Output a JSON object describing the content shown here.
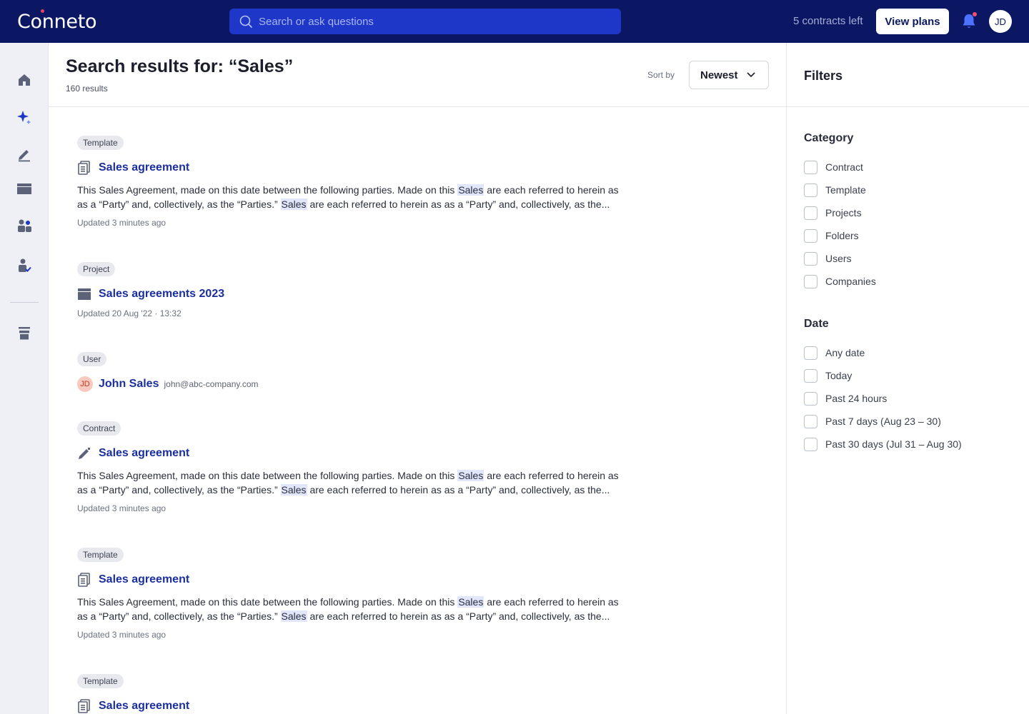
{
  "topbar": {
    "logo": "Conneto",
    "search_placeholder": "Search or ask questions",
    "contracts_left": "5 contracts left",
    "view_plans": "View plans",
    "avatar_initials": "JD",
    "bg_color": "#0c1763"
  },
  "rail": {
    "icons": [
      "home-icon",
      "sparkle-icon",
      "pen-icon",
      "folder-icon",
      "users-icon",
      "user-check-icon",
      "trash-icon"
    ]
  },
  "header": {
    "title": "Search results for: “Sales”",
    "count": "160 results",
    "sort_label": "Sort by",
    "sort_value": "Newest"
  },
  "results": [
    {
      "tag": "Template",
      "icon": "document-icon",
      "title": "Sales agreement",
      "line1_a": "This Sales Agreement, made on this date between the following parties. Made on this",
      "line1_hl": "Sales",
      "line1_b": "are each referred to herein as",
      "line2_a": "as a “Party” and, collectively, as the “Parties.”",
      "line2_hl": "Sales",
      "line2_b": "are each referred to herein as as a “Party” and, collectively, as the...",
      "updated": "Updated 3 minutes ago"
    },
    {
      "tag": "Project",
      "icon": "folder-icon",
      "title": "Sales agreements 2023",
      "updated": "Updated 20 Aug '22 · 13:32"
    },
    {
      "tag": "User",
      "avatar": "JD",
      "title": "John Sales",
      "email": "john@abc-company.com"
    },
    {
      "tag": "Contract",
      "icon": "pen-icon",
      "title": "Sales agreement",
      "line1_a": "This Sales Agreement, made on this date between the following parties. Made on this",
      "line1_hl": "Sales",
      "line1_b": "are each referred to herein as",
      "line2_a": "as a “Party” and, collectively, as the “Parties.”",
      "line2_hl": "Sales",
      "line2_b": "are each referred to herein as as a “Party” and, collectively, as the...",
      "updated": "Updated 3 minutes ago"
    },
    {
      "tag": "Template",
      "icon": "document-icon",
      "title": "Sales agreement",
      "line1_a": "This Sales Agreement, made on this date between the following parties. Made on this",
      "line1_hl": "Sales",
      "line1_b": "are each referred to herein as",
      "line2_a": "as a “Party” and, collectively, as the “Parties.”",
      "line2_hl": "Sales",
      "line2_b": "are each referred to herein as as a “Party” and, collectively, as the...",
      "updated": "Updated 3 minutes ago"
    },
    {
      "tag": "Template",
      "icon": "document-icon",
      "title": "Sales agreement"
    }
  ],
  "filters": {
    "title": "Filters",
    "category": {
      "title": "Category",
      "options": [
        "Contract",
        "Template",
        "Projects",
        "Folders",
        "Users",
        "Companies"
      ]
    },
    "date": {
      "title": "Date",
      "options": [
        "Any date",
        "Today",
        "Past 24 hours",
        "Past 7 days (Aug 23 – 30)",
        "Past 30 days (Jul 31 – Aug 30)"
      ]
    }
  }
}
